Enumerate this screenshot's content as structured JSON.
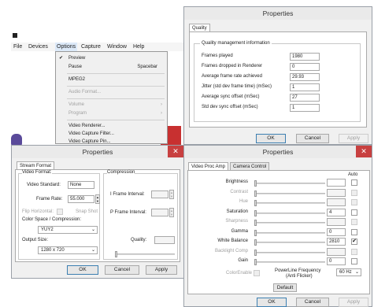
{
  "app": {
    "icon": "app-icon",
    "menubar": [
      "File",
      "Devices",
      "Options",
      "Capture",
      "Window",
      "Help"
    ],
    "title_bar_color": "#000000"
  },
  "options_menu": {
    "items": [
      {
        "label": "Preview",
        "shortcut": "",
        "checked": true,
        "enabled": true
      },
      {
        "label": "Pause",
        "shortcut": "Spacebar",
        "checked": false,
        "enabled": true
      },
      {
        "label": "MPEG2",
        "shortcut": "",
        "checked": false,
        "enabled": true
      },
      {
        "label": "Audio Format...",
        "shortcut": "",
        "checked": false,
        "enabled": false
      },
      {
        "label": "Volume",
        "shortcut": "",
        "submenu": true,
        "enabled": false
      },
      {
        "label": "Program",
        "shortcut": "",
        "submenu": true,
        "enabled": false
      },
      {
        "label": "Video Renderer...",
        "shortcut": "",
        "checked": false,
        "enabled": true
      },
      {
        "label": "Video Capture Filter...",
        "shortcut": "",
        "checked": false,
        "enabled": true
      },
      {
        "label": "Video Capture Pin...",
        "shortcut": "",
        "checked": false,
        "enabled": true
      }
    ]
  },
  "quality_dialog": {
    "title": "Properties",
    "tab": "Quality",
    "group": "Quality management information",
    "rows": [
      {
        "label": "Frames played",
        "value": "1980"
      },
      {
        "label": "Frames dropped in Renderer",
        "value": "0"
      },
      {
        "label": "Average frame rate achieved",
        "value": "29.93"
      },
      {
        "label": "Jitter (std dev frame time) (mSec)",
        "value": "1"
      },
      {
        "label": "Average sync offset (mSec)",
        "value": "27"
      },
      {
        "label": "Std dev sync offset (mSec)",
        "value": "1"
      }
    ],
    "ok": "OK",
    "cancel": "Cancel",
    "apply": "Apply"
  },
  "stream_dialog": {
    "title": "Properties",
    "tab": "Stream Format",
    "video_format": "Video Format:",
    "video_standard_label": "Video Standard:",
    "video_standard": "None",
    "frame_rate_label": "Frame Rate:",
    "frame_rate": "55.000",
    "flip_label": "Flip Horizontal:",
    "snap_label": "Snap Shot",
    "color_space_label": "Color Space / Compression:",
    "color_space": "YUY2",
    "output_size_label": "Output Size:",
    "output_size": "1280 x 720",
    "compression": "Compression",
    "iframe_label": "I Frame Interval:",
    "pframe_label": "P Frame Interval:",
    "quality_label": "Quality:",
    "ok": "OK",
    "cancel": "Cancel",
    "apply": "Apply"
  },
  "procamp_dialog": {
    "title": "Properties",
    "tabs": [
      "Video Proc Amp",
      "Camera Control"
    ],
    "auto": "Auto",
    "rows": [
      {
        "label": "Brightness",
        "value": "",
        "enabled": true,
        "level": 0.0
      },
      {
        "label": "Contrast",
        "value": "",
        "enabled": false,
        "level": 0.0
      },
      {
        "label": "Hue",
        "value": "",
        "enabled": false,
        "level": 0.0
      },
      {
        "label": "Saturation",
        "value": "4",
        "enabled": true,
        "level": 0.0
      },
      {
        "label": "Sharpness",
        "value": "",
        "enabled": false,
        "level": 0.0
      },
      {
        "label": "Gamma",
        "value": "0",
        "enabled": true,
        "level": 0.0
      },
      {
        "label": "White Balance",
        "value": "2810",
        "enabled": true,
        "level": 0.0,
        "auto_checked": true
      },
      {
        "label": "Backlight Comp",
        "value": "",
        "enabled": false,
        "level": 0.0
      },
      {
        "label": "Gain",
        "value": "0",
        "enabled": true,
        "level": 0.0
      }
    ],
    "color_enable": "ColorEnable",
    "powerline": "PowerLine Frequency",
    "anti_flicker": "(Anti Flicker)",
    "powerline_value": "60 Hz",
    "default": "Default",
    "ok": "OK",
    "cancel": "Cancel",
    "apply": "Apply"
  },
  "colors": {
    "close_button": "#c84040",
    "accent": "#3c7fb1"
  }
}
